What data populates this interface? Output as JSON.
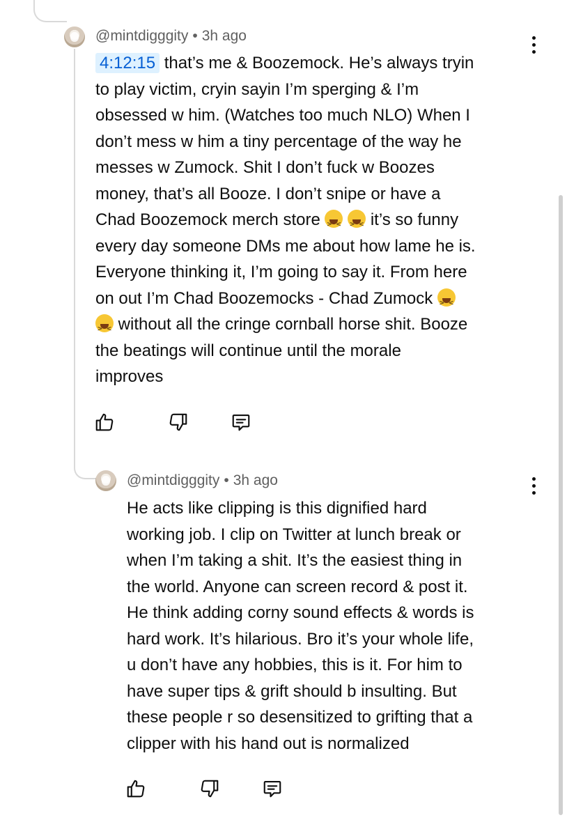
{
  "comments": [
    {
      "author": "@mintdigggity",
      "separator": "•",
      "time": "3h ago",
      "timestamp_link": "4:12:15",
      "text_lines": [
        " that’s me & Boozemock. He’s always tryin",
        "to play victim, cryin sayin I’m sperging & I’m",
        "obsessed w him. (Watches too much NLO) When I",
        "don’t mess w him a tiny percentage of the way he",
        "messes w Zumock. Shit I don’t fuck w Boozes",
        "money, that’s all Booze. I don’t snipe or have a",
        "Chad Boozemock merch store",
        " it’s so funny",
        "every day someone DMs me about how lame he is.",
        "Everyone thinking it, I’m going to say it. From here",
        "on out I’m Chad Boozemocks - Chad Zumock",
        " without all the cringe cornball horse shit. Booze",
        "the beatings will continue until the morale",
        "improves"
      ]
    },
    {
      "author": "@mintdigggity",
      "separator": "•",
      "time": "3h ago",
      "text_lines": [
        "He acts like clipping is this dignified hard",
        "working job. I clip on Twitter at lunch break or",
        "when I’m taking a shit. It’s the easiest thing in",
        "the world. Anyone can screen record & post it.",
        "He think adding corny sound effects & words is",
        "hard work. It’s hilarious. Bro it’s your whole life,",
        "u don’t have any hobbies, this is it. For him to",
        "have super tips & grift should b insulting. But",
        "these people r so desensitized to grifting that a",
        "clipper with his hand out is normalized"
      ]
    }
  ],
  "icons": {
    "like": "thumbs-up-icon",
    "dislike": "thumbs-down-icon",
    "reply": "comment-icon",
    "menu": "more-vert-icon",
    "emoji": "grinning-squinting-face-emoji"
  }
}
